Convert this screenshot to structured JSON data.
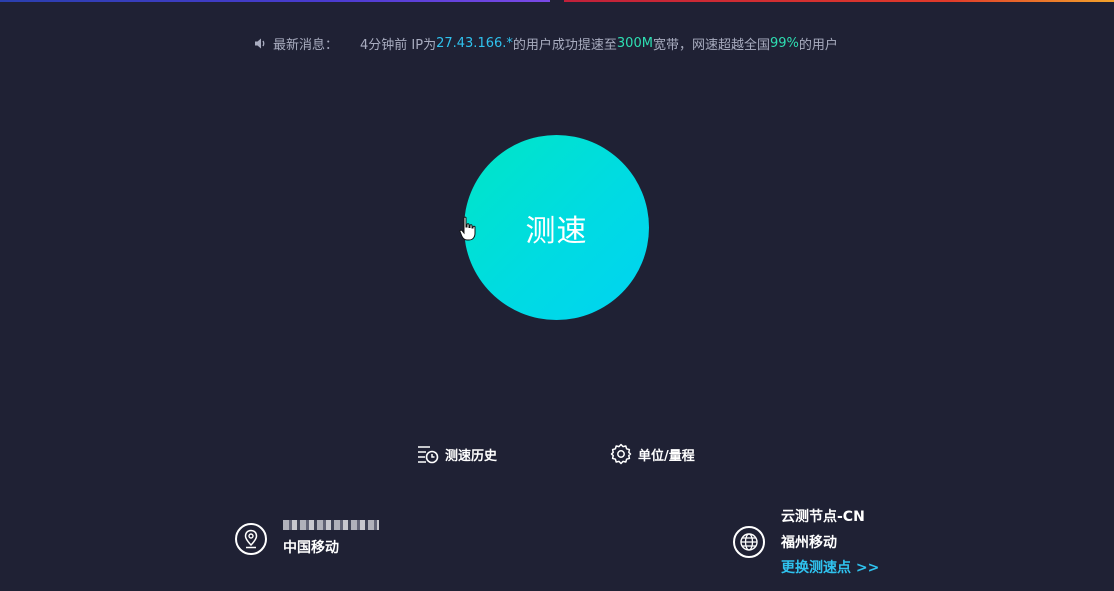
{
  "news": {
    "label": "最新消息：",
    "prefix": "4分钟前 IP为",
    "ip": "27.43.166.*",
    "middle": "的用户成功提速至",
    "bandwidth": "300M",
    "suffix1": "宽带，网速超越全国",
    "percent": "99%",
    "suffix2": "的用户"
  },
  "speed_test": {
    "button_label": "测速"
  },
  "actions": {
    "history_label": "测速历史",
    "units_label": "单位/量程"
  },
  "local": {
    "isp": "中国移动"
  },
  "node": {
    "name": "云测节点-CN",
    "isp": "福州移动",
    "change_label": "更换测速点 >>"
  },
  "colors": {
    "background": "#1f2134",
    "accent_blue": "#2fc2ee",
    "accent_green": "#2edfb3",
    "button_gradient_start": "#00e6c6",
    "button_gradient_end": "#00d3f2"
  },
  "icons": {
    "news": "speaker-icon",
    "history": "history-list-icon",
    "units": "gear-icon",
    "local": "location-pin-icon",
    "node": "globe-icon"
  }
}
